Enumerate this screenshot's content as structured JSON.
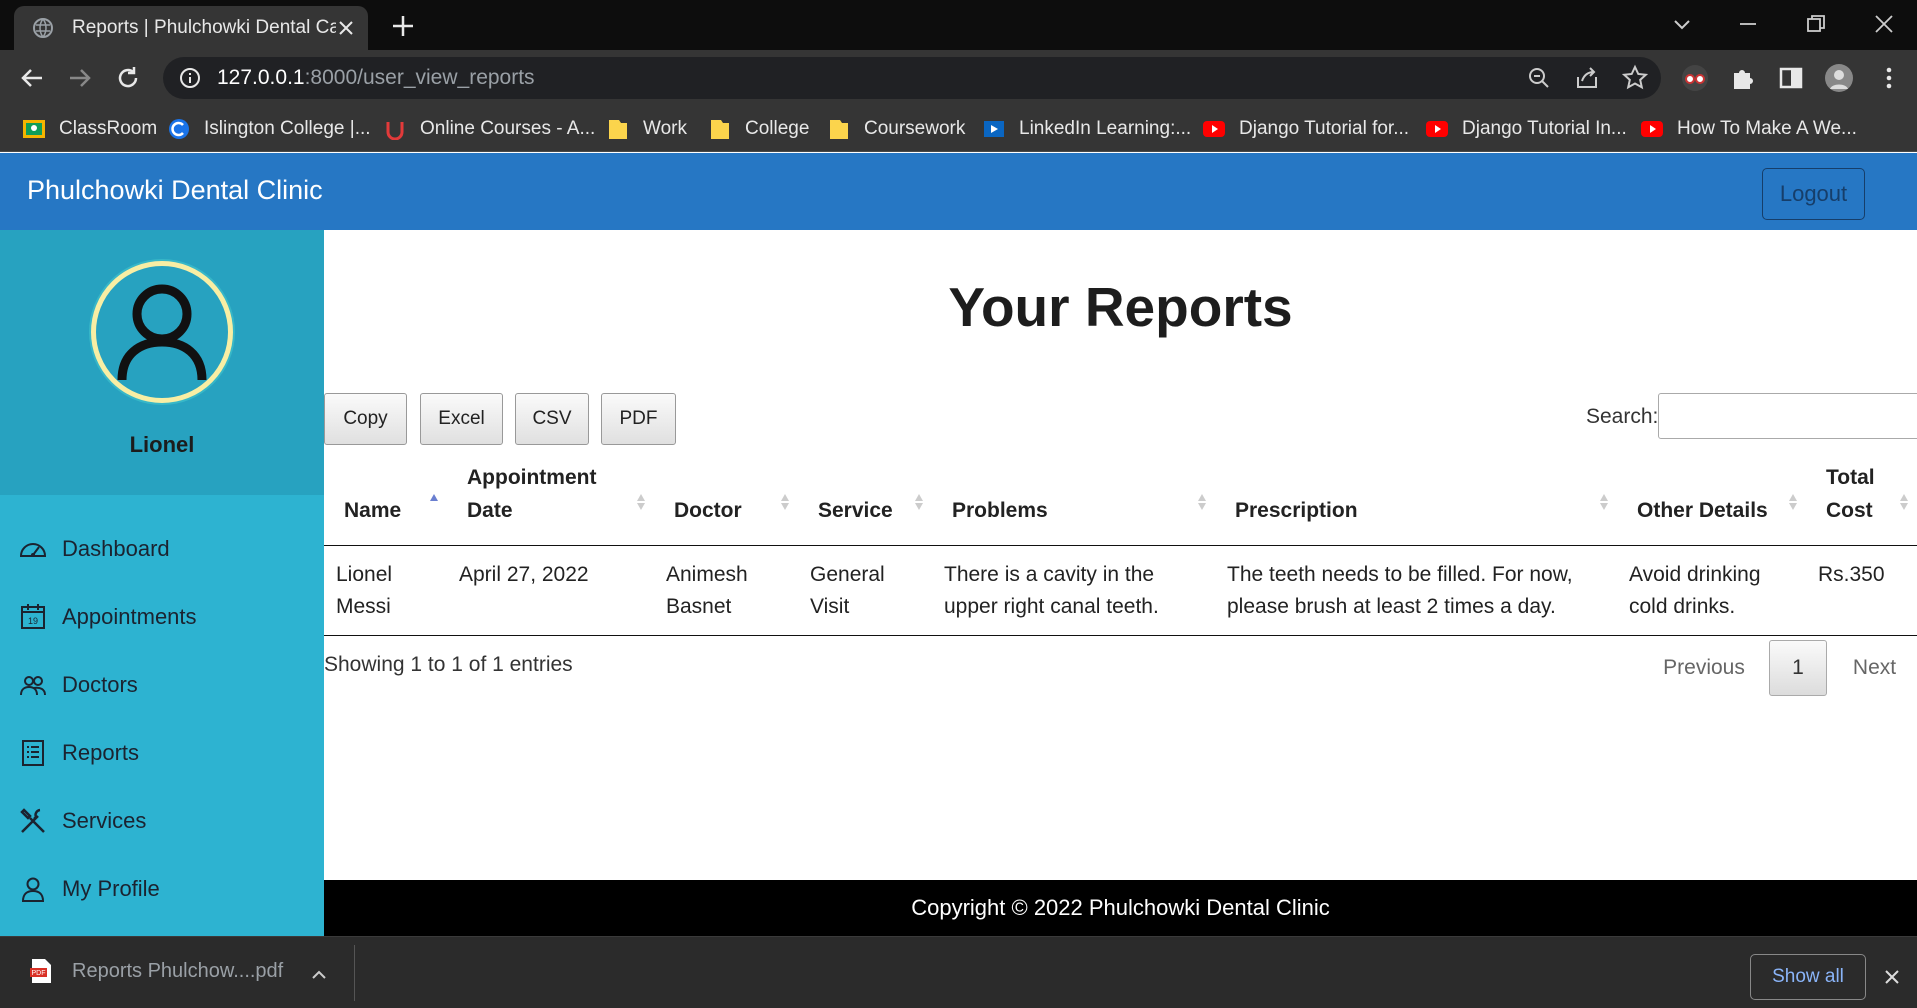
{
  "browser": {
    "tab_title": "Reports | Phulchowki Dental Care",
    "url_host": "127.0.0.1",
    "url_path": ":8000/user_view_reports",
    "bookmarks": [
      {
        "label": "ClassRoom",
        "icon": "classroom-icon"
      },
      {
        "label": "Islington College |...",
        "icon": "college-icon"
      },
      {
        "label": "Online Courses - A...",
        "icon": "udemy-icon"
      },
      {
        "label": "Work",
        "icon": "folder-icon"
      },
      {
        "label": "College",
        "icon": "folder-icon"
      },
      {
        "label": "Coursework",
        "icon": "folder-icon"
      },
      {
        "label": "LinkedIn Learning:...",
        "icon": "linkedin-learning-icon"
      },
      {
        "label": "Django Tutorial for...",
        "icon": "youtube-icon"
      },
      {
        "label": "Django Tutorial In...",
        "icon": "youtube-icon"
      },
      {
        "label": "How To Make A We...",
        "icon": "youtube-icon"
      }
    ]
  },
  "navbar": {
    "brand": "Phulchowki Dental Clinic",
    "logout_label": "Logout"
  },
  "sidebar": {
    "user_name": "Lionel",
    "items": [
      {
        "label": "Dashboard",
        "icon": "dashboard-icon"
      },
      {
        "label": "Appointments",
        "icon": "calendar-icon"
      },
      {
        "label": "Doctors",
        "icon": "doctors-icon"
      },
      {
        "label": "Reports",
        "icon": "reports-icon"
      },
      {
        "label": "Services",
        "icon": "tools-icon"
      },
      {
        "label": "My Profile",
        "icon": "user-icon"
      }
    ]
  },
  "main": {
    "title": "Your Reports",
    "export_buttons": [
      "Copy",
      "Excel",
      "CSV",
      "PDF"
    ],
    "search_label": "Search:",
    "search_value": "",
    "table": {
      "headers": [
        "Name",
        "Appointment Date",
        "Doctor",
        "Service",
        "Problems",
        "Prescription",
        "Other Details",
        "Total Cost"
      ],
      "rows": [
        [
          "Lionel Messi",
          "April 27, 2022",
          "Animesh Basnet",
          "General Visit",
          "There is a cavity in the upper right canal teeth.",
          "The teeth needs to be filled. For now, please brush at least 2 times a day.",
          "Avoid drinking cold drinks.",
          "Rs.350"
        ]
      ]
    },
    "info": "Showing 1 to 1 of 1 entries",
    "pagination": {
      "previous": "Previous",
      "current": "1",
      "next": "Next"
    }
  },
  "footer": "Copyright © 2022 Phulchowki Dental Clinic",
  "downloads": {
    "file": "Reports  Phulchow....pdf",
    "show_all": "Show all"
  },
  "colors": {
    "navbar": "#2677c4",
    "sidebar": "#2db3d1",
    "profile_panel": "#27a2c0",
    "avatar_ring": "#f8eea4"
  }
}
